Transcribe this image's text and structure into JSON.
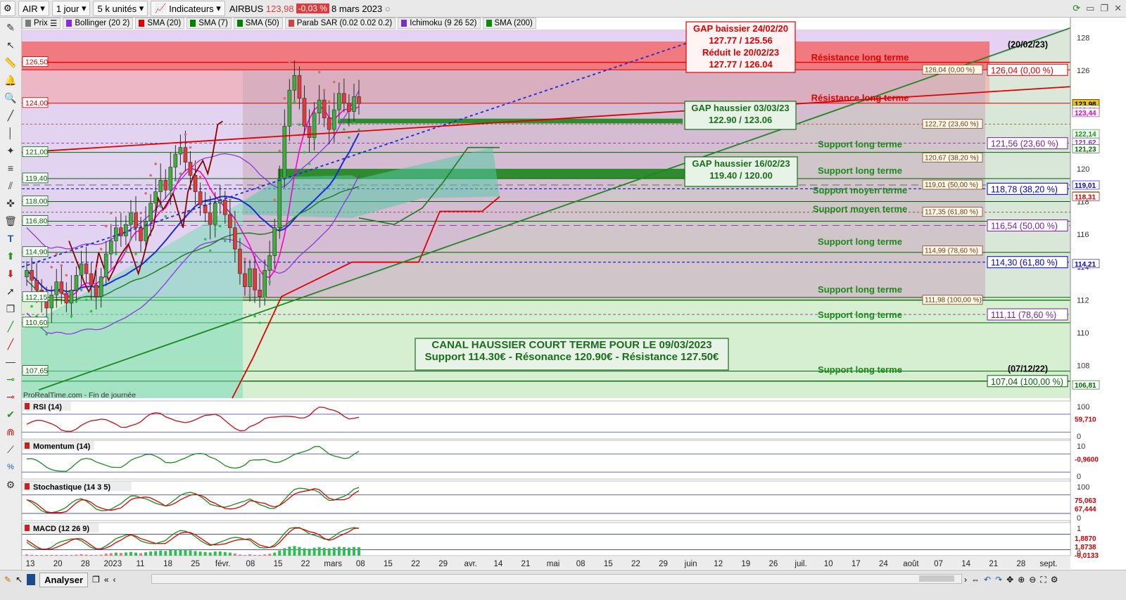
{
  "toolbar": {
    "symbol": "AIR",
    "period": "1 jour",
    "units": "5 k unités",
    "indicators_label": "Indicateurs",
    "instrument": "AIRBUS",
    "price": "123,98",
    "change": "-0,03 %",
    "date": "8 mars 2023"
  },
  "indicator_tags": [
    "Prix",
    "Bollinger (20 2)",
    "SMA (20)",
    "SMA (7)",
    "SMA (50)",
    "Parab SAR (0.02 0.02 0.2)",
    "Ichimoku (9 26 52)",
    "SMA (200)"
  ],
  "indicator_colors": [
    "#7b7b7b",
    "#8a2be2",
    "#e00000",
    "#008000",
    "#008000",
    "#cc4444",
    "#7a2fc0",
    "#0a8a0a"
  ],
  "watermark": "ProRealTime.com - Fin de journée",
  "bottom_label": "Analyser",
  "chart_data": {
    "type": "candlestick",
    "instrument": "AIRBUS",
    "timeframe": "1 jour",
    "ylim": [
      106,
      128.5
    ],
    "right_axis_ticks": [
      "128",
      "126",
      "124",
      "122",
      "120",
      "118",
      "116",
      "114",
      "112",
      "110",
      "108"
    ],
    "x_ticks": [
      "13",
      "20",
      "28",
      "2023",
      "11",
      "18",
      "25",
      "févr.",
      "08",
      "15",
      "22",
      "mars",
      "08",
      "15",
      "22",
      "29",
      "avr.",
      "14",
      "21",
      "mai",
      "08",
      "15",
      "22",
      "29",
      "juin",
      "12",
      "19",
      "26",
      "juil.",
      "10",
      "17",
      "24",
      "août",
      "07",
      "14",
      "21",
      "28",
      "sept."
    ],
    "price_badges": [
      {
        "text": "123,98",
        "value": 123.98,
        "bg": "#f1c40f",
        "fg": "#000000"
      },
      {
        "text": "123,61",
        "value": 123.61,
        "bg": "#ffffff",
        "fg": "#008800"
      },
      {
        "text": "123,44",
        "value": 123.44,
        "bg": "#ffffff",
        "fg": "#e000c0"
      },
      {
        "text": "122,14",
        "value": 122.14,
        "bg": "#ffffff",
        "fg": "#00a000"
      },
      {
        "text": "121,62",
        "value": 121.62,
        "bg": "#ffffff",
        "fg": "#8a2be2"
      },
      {
        "text": "121,23",
        "value": 121.23,
        "bg": "#ffffff",
        "fg": "#006400"
      },
      {
        "text": "119,01",
        "value": 119.01,
        "bg": "#ffffff",
        "fg": "#0000cc"
      },
      {
        "text": "118,34",
        "value": 118.34,
        "bg": "#ffffff",
        "fg": "#008000"
      },
      {
        "text": "118,31",
        "value": 118.31,
        "bg": "#ffffff",
        "fg": "#cc0000"
      },
      {
        "text": "114,21",
        "value": 114.21,
        "bg": "#ffffff",
        "fg": "#0000cc"
      },
      {
        "text": "106,81",
        "value": 106.81,
        "bg": "#ffffff",
        "fg": "#006400"
      }
    ],
    "left_levels": [
      {
        "text": "126,50",
        "value": 126.5,
        "color": "#cc0000"
      },
      {
        "text": "124,00",
        "value": 124.0,
        "color": "#cc0000"
      },
      {
        "text": "121,00",
        "value": 121.0,
        "color": "#006400"
      },
      {
        "text": "119,40",
        "value": 119.4,
        "color": "#006400"
      },
      {
        "text": "118,00",
        "value": 118.0,
        "color": "#006400"
      },
      {
        "text": "116,80",
        "value": 116.8,
        "color": "#006400"
      },
      {
        "text": "114,90",
        "value": 114.9,
        "color": "#006400"
      },
      {
        "text": "112,15",
        "value": 112.15,
        "color": "#006400"
      },
      {
        "text": "110,60",
        "value": 110.6,
        "color": "#006400"
      },
      {
        "text": "107,65",
        "value": 107.65,
        "color": "#006400"
      }
    ],
    "fib_left": [
      {
        "text": "126,04 (0,00 %)",
        "value": 126.04
      },
      {
        "text": "122,72 (23,60 %)",
        "value": 122.72
      },
      {
        "text": "120,67 (38,20 %)",
        "value": 120.67
      },
      {
        "text": "119,01 (50,00 %)",
        "value": 119.01
      },
      {
        "text": "117,35 (61,80 %)",
        "value": 117.35
      },
      {
        "text": "114,99 (78,60 %)",
        "value": 114.99
      },
      {
        "text": "111,98 (100,00 %)",
        "value": 111.98
      }
    ],
    "fib_right": [
      {
        "text": "126,04 (0,00 %)",
        "value": 126.04,
        "color": "#e00000"
      },
      {
        "text": "121,56 (23,60 %)",
        "value": 121.56,
        "color": "#7a1fa0"
      },
      {
        "text": "118,78 (38,20 %)",
        "value": 118.78,
        "color": "#0000cc"
      },
      {
        "text": "116,54 (50,00 %)",
        "value": 116.54,
        "color": "#7a1fa0"
      },
      {
        "text": "114,30 (61,80 %)",
        "value": 114.3,
        "color": "#0000cc"
      },
      {
        "text": "111,11 (78,60 %)",
        "value": 111.11,
        "color": "#7a1fa0"
      },
      {
        "text": "107,04 (100,00 %)",
        "value": 107.04,
        "color": "#006400"
      }
    ],
    "fib_right_dates": [
      "(20/02/23)",
      "(07/12/22)"
    ],
    "zone_labels": [
      {
        "text": "Résistance long terme",
        "value": 126.6,
        "color": "#e00000"
      },
      {
        "text": "Résistance long terme",
        "value": 124.15,
        "color": "#e00000"
      },
      {
        "text": "Support long terme",
        "value": 121.3,
        "color": "#1a8a1a"
      },
      {
        "text": "Support long terme",
        "value": 119.7,
        "color": "#1a8a1a"
      },
      {
        "text": "Support moyen terme",
        "value": 118.5,
        "color": "#1a8a1a"
      },
      {
        "text": "Support moyen terme",
        "value": 117.35,
        "color": "#1a8a1a"
      },
      {
        "text": "Support long terme",
        "value": 115.35,
        "color": "#1a8a1a"
      },
      {
        "text": "Support long terme",
        "value": 112.45,
        "color": "#1a8a1a"
      },
      {
        "text": "Support long terme",
        "value": 110.9,
        "color": "#1a8a1a"
      },
      {
        "text": "Support long terme",
        "value": 107.55,
        "color": "#1a8a1a"
      }
    ],
    "annotations": [
      {
        "lines": [
          "GAP baissier 24/02/20",
          "127.77 / 125.56",
          "Réduit le 20/02/23",
          "127.77 / 126.04"
        ],
        "color": "#e00000",
        "bg": "#fff3f3"
      },
      {
        "lines": [
          "GAP haussier 03/03/23",
          "122.90 / 123.06"
        ],
        "color": "#1a6e1a",
        "bg": "#e8f3e8"
      },
      {
        "lines": [
          "GAP haussier 16/02/23",
          "119.40 / 120.00"
        ],
        "color": "#1a6e1a",
        "bg": "#e8f3e8"
      },
      {
        "lines": [
          "CANAL HAUSSIER COURT TERME POUR LE 09/03/2023",
          "Support 114.30€ - Résonance 120.90€ - Résistance 127.50€"
        ],
        "color": "#1a6e1a",
        "bg": "#e8f3e8"
      }
    ],
    "closes": [
      113.8,
      113.2,
      112.6,
      111.9,
      111.5,
      112.3,
      113.1,
      112.4,
      111.8,
      112.6,
      113.5,
      114.2,
      113.6,
      112.9,
      112.2,
      113.4,
      114.8,
      115.6,
      116.4,
      115.9,
      116.6,
      117.3,
      116.4,
      115.6,
      116.8,
      117.9,
      118.6,
      119.3,
      118.7,
      120.1,
      120.9,
      121.3,
      120.4,
      119.6,
      118.6,
      117.8,
      117.3,
      116.6,
      117.9,
      118.1,
      117.2,
      116.4,
      115.1,
      113.6,
      112.8,
      113.9,
      112.6,
      112.2,
      113.8,
      114.7,
      116.4,
      119.4,
      122.6,
      124.8,
      125.7,
      124.3,
      122.6,
      121.9,
      123.4,
      124.2,
      123.1,
      122.4,
      123.6,
      124.6,
      124.0,
      123.5,
      124.4,
      123.98
    ],
    "panels": [
      {
        "name": "RSI (14)",
        "ticks": [
          "100",
          "0"
        ],
        "badges": [
          {
            "text": "59,710",
            "fg": "#cc0000"
          }
        ]
      },
      {
        "name": "Momentum (14)",
        "ticks": [
          "10",
          "0"
        ],
        "badges": [
          {
            "text": "-0,9600",
            "fg": "#cc0000"
          }
        ]
      },
      {
        "name": "Stochastique (14 3 5)",
        "ticks": [
          "100",
          "0"
        ],
        "badges": [
          {
            "text": "75,063",
            "fg": "#cc0000"
          },
          {
            "text": "67,444",
            "fg": "#cc0000"
          }
        ]
      },
      {
        "name": "MACD (12 26 9)",
        "ticks": [
          "1",
          "0"
        ],
        "badges": [
          {
            "text": "1,8870",
            "fg": "#cc0000"
          },
          {
            "text": "1,8738",
            "fg": "#cc0000"
          },
          {
            "text": "-0,0133",
            "fg": "#cc0000"
          }
        ]
      }
    ]
  }
}
